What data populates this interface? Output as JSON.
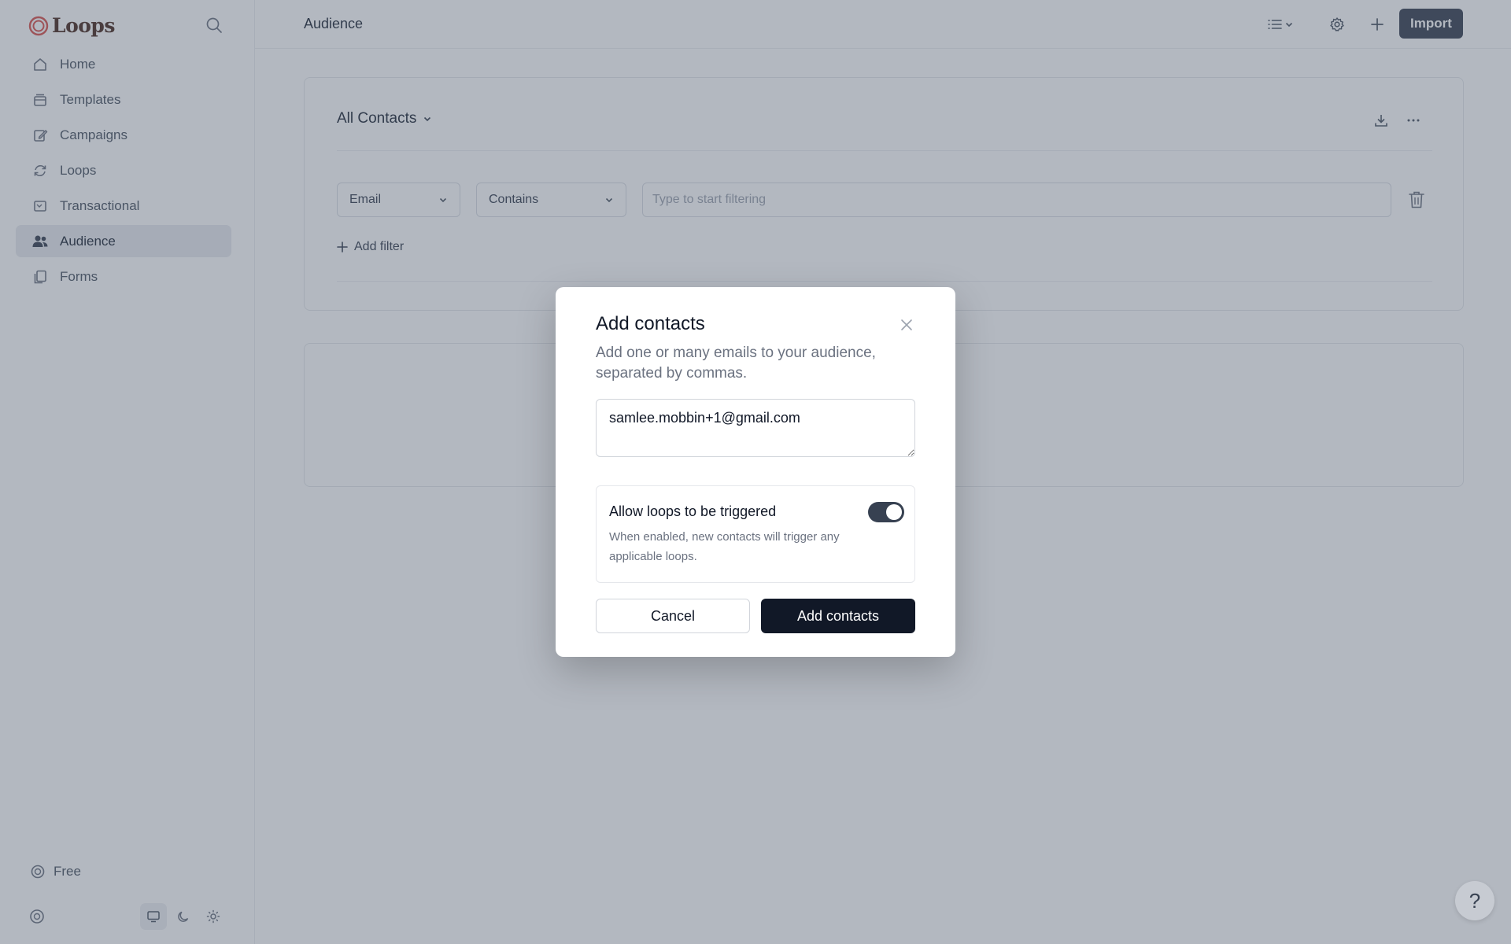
{
  "app": {
    "name": "Loops"
  },
  "sidebar": {
    "items": [
      {
        "label": "Home",
        "icon": "home-icon",
        "active": false
      },
      {
        "label": "Templates",
        "icon": "templates-icon",
        "active": false
      },
      {
        "label": "Campaigns",
        "icon": "pencil-icon",
        "active": false
      },
      {
        "label": "Loops",
        "icon": "refresh-icon",
        "active": false
      },
      {
        "label": "Transactional",
        "icon": "transactional-icon",
        "active": false
      },
      {
        "label": "Audience",
        "icon": "users-icon",
        "active": true
      },
      {
        "label": "Forms",
        "icon": "forms-icon",
        "active": false
      }
    ],
    "plan_label": "Free"
  },
  "header": {
    "title": "Audience",
    "import_label": "Import"
  },
  "main": {
    "view_title": "All Contacts",
    "filter": {
      "field": "Email",
      "operator": "Contains",
      "placeholder": "Type to start filtering",
      "add_filter_label": "Add filter"
    }
  },
  "modal": {
    "title": "Add contacts",
    "description": "Add one or many emails to your audience, separated by commas.",
    "emails_value": "samlee.mobbin+1@gmail.com",
    "toggle": {
      "title": "Allow loops to be triggered",
      "description": "When enabled, new contacts will trigger any applicable loops.",
      "enabled": true
    },
    "cancel_label": "Cancel",
    "submit_label": "Add contacts"
  },
  "help_label": "?",
  "colors": {
    "accent": "#374151",
    "primary_button": "#111827",
    "logo": "#d9534f"
  }
}
